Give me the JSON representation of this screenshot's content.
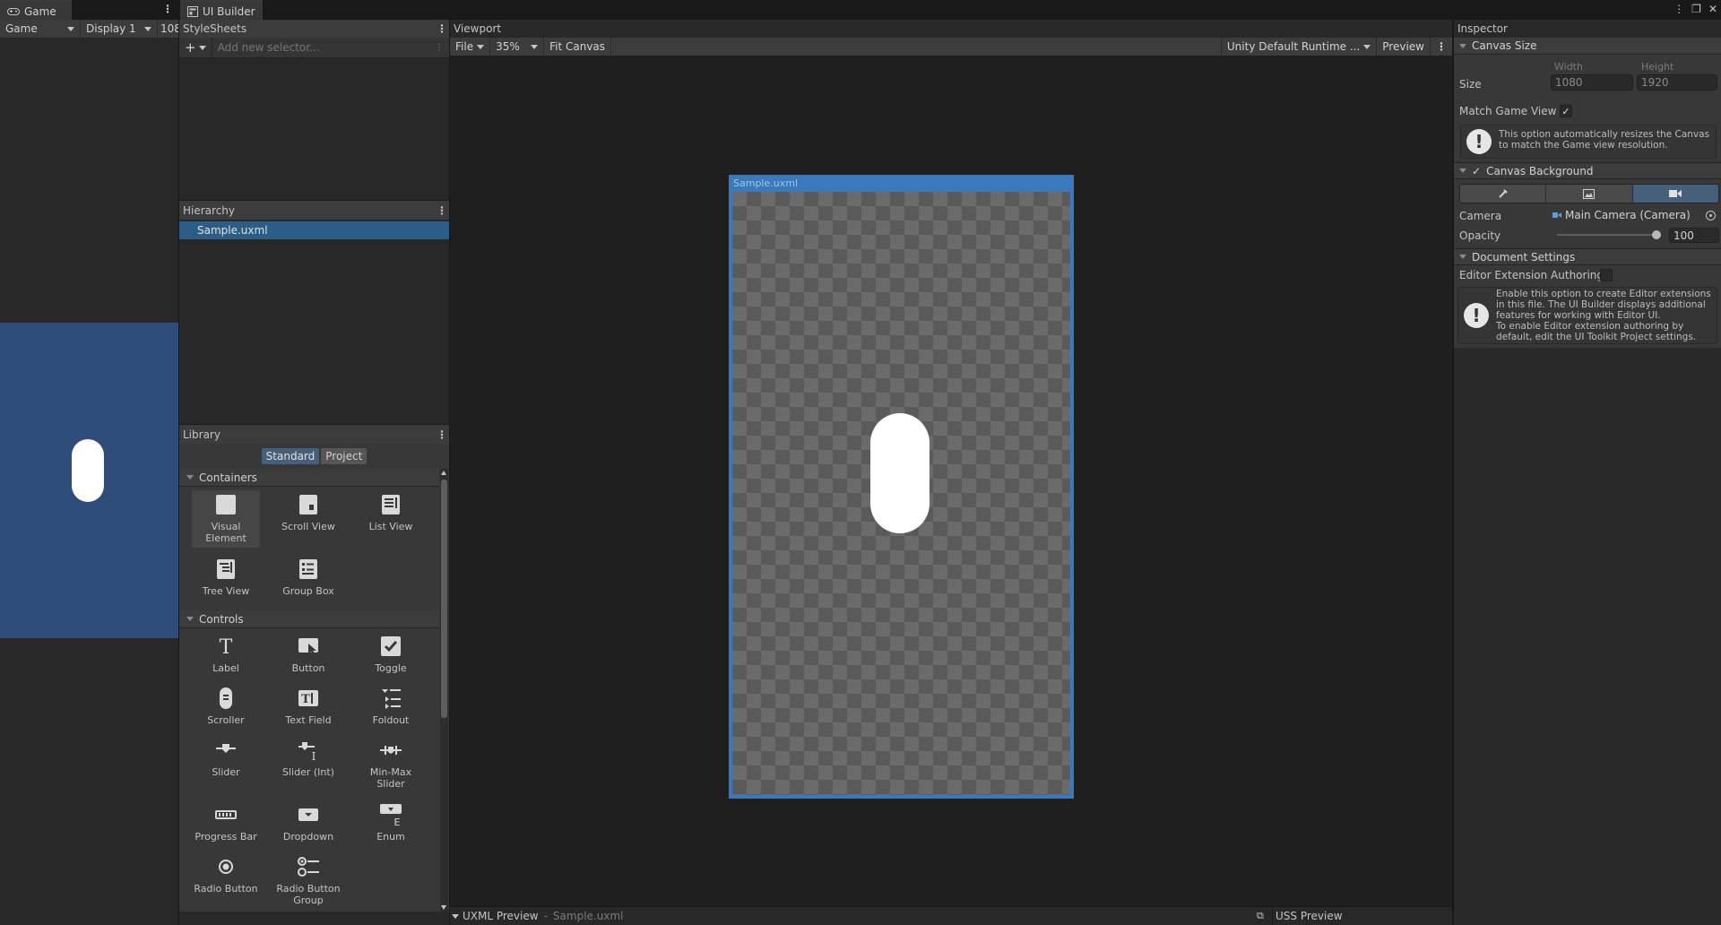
{
  "tabs": {
    "game": "Game",
    "ui_builder": "UI Builder"
  },
  "game": {
    "mode": "Game",
    "display": "Display 1",
    "resolution_partial": "108"
  },
  "stylesheets": {
    "title": "StyleSheets",
    "add_selector_placeholder": "Add new selector..."
  },
  "hierarchy": {
    "title": "Hierarchy",
    "selected_item": "Sample.uxml"
  },
  "library": {
    "title": "Library",
    "tabs": [
      "Standard",
      "Project"
    ],
    "containers_label": "Containers",
    "controls_label": "Controls",
    "containers": [
      {
        "label": "Visual Element",
        "icon": "visual-element-icon"
      },
      {
        "label": "Scroll View",
        "icon": "scroll-view-icon"
      },
      {
        "label": "List View",
        "icon": "list-view-icon"
      },
      {
        "label": "Tree View",
        "icon": "tree-view-icon"
      },
      {
        "label": "Group Box",
        "icon": "group-box-icon"
      }
    ],
    "controls": [
      {
        "label": "Label",
        "icon": "label-icon"
      },
      {
        "label": "Button",
        "icon": "button-icon"
      },
      {
        "label": "Toggle",
        "icon": "toggle-icon"
      },
      {
        "label": "Scroller",
        "icon": "scroller-icon"
      },
      {
        "label": "Text Field",
        "icon": "text-field-icon"
      },
      {
        "label": "Foldout",
        "icon": "foldout-icon"
      },
      {
        "label": "Slider",
        "icon": "slider-icon"
      },
      {
        "label": "Slider (Int)",
        "icon": "slider-int-icon"
      },
      {
        "label": "Min-Max Slider",
        "icon": "min-max-slider-icon"
      },
      {
        "label": "Progress Bar",
        "icon": "progress-bar-icon"
      },
      {
        "label": "Dropdown",
        "icon": "dropdown-icon"
      },
      {
        "label": "Enum",
        "icon": "enum-icon"
      },
      {
        "label": "Radio Button",
        "icon": "radio-button-icon"
      },
      {
        "label": "Radio Button Group",
        "icon": "radio-button-group-icon"
      }
    ]
  },
  "viewport": {
    "title": "Viewport",
    "file_menu": "File",
    "zoom": "35%",
    "fit_canvas": "Fit Canvas",
    "theme": "Unity Default Runtime ...",
    "preview": "Preview",
    "canvas_title": "Sample.uxml",
    "uxml_preview": "UXML Preview",
    "uxml_preview_separator": "-",
    "uxml_preview_file": "Sample.uxml",
    "uss_preview": "USS Preview"
  },
  "inspector": {
    "title": "Inspector",
    "canvas_size": {
      "header": "Canvas Size",
      "size_label": "Size",
      "width_label": "Width",
      "height_label": "Height",
      "width_value": "1080",
      "height_value": "1920",
      "match_label": "Match Game View",
      "match_checked": true,
      "help": "This option automatically resizes the Canvas to match the Game view resolution."
    },
    "canvas_background": {
      "header": "Canvas Background",
      "enabled": true,
      "camera_label": "Camera",
      "camera_value": "Main Camera (Camera)",
      "opacity_label": "Opacity",
      "opacity_value": "100",
      "opacity_fraction": 1.0
    },
    "document_settings": {
      "header": "Document Settings",
      "editor_ext_label": "Editor Extension Authoring",
      "editor_ext_checked": false,
      "help": "Enable this option to create Editor extensions in this file. The UI Builder displays additional features for working with Editor UI.\nTo enable Editor extension authoring by default, edit the UI Toolkit Project settings."
    }
  },
  "colors": {
    "selection_blue": "#2c5d87",
    "canvas_border": "#3a79bb",
    "game_bg": "#2f4d7a",
    "panel_bg": "#383838",
    "dark_bg": "#282828"
  }
}
